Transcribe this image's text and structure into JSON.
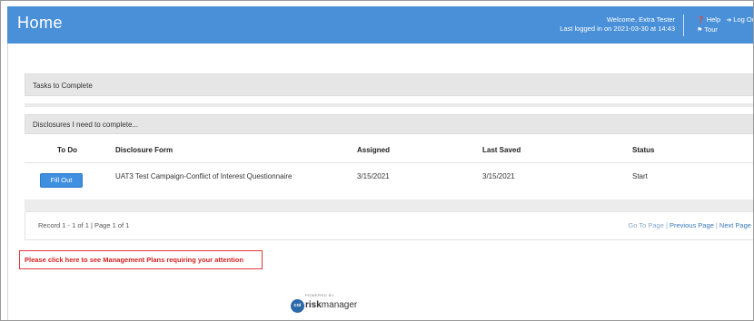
{
  "header": {
    "title": "Home",
    "welcome_line1": "Welcome, Extra Tester",
    "welcome_line2": "Last logged in on 2021-03-30 at 14:43",
    "help_label": "Help",
    "logout_label": "Log Out",
    "tour_label": "Tour",
    "accent_color": "#4a90d9"
  },
  "tasks": {
    "heading": "Tasks to Complete"
  },
  "disclosures": {
    "heading": "Disclosures I need to complete...",
    "columns": [
      "To Do",
      "Disclosure Form",
      "Assigned",
      "Last Saved",
      "Status"
    ],
    "rows": [
      {
        "action_label": "Fill Out",
        "form": "UAT3 Test Campaign-Conflict of Interest Questionnaire",
        "assigned": "3/15/2021",
        "last_saved": "3/15/2021",
        "status": "Start"
      }
    ]
  },
  "pager": {
    "record_text": "Record 1 - 1 of 1 | Page 1 of 1",
    "go_to_page": "Go To Page",
    "previous_page": "Previous Page",
    "next_page": "Next Page",
    "separator": " | "
  },
  "management": {
    "link_text": "Please click here to see Management Plans requiring your attention",
    "highlight_color": "#e03a3a"
  },
  "footer": {
    "powered_by": "POWERED BY",
    "logo_badge": "coi",
    "logo_bold": "risk",
    "logo_light": "manager"
  }
}
